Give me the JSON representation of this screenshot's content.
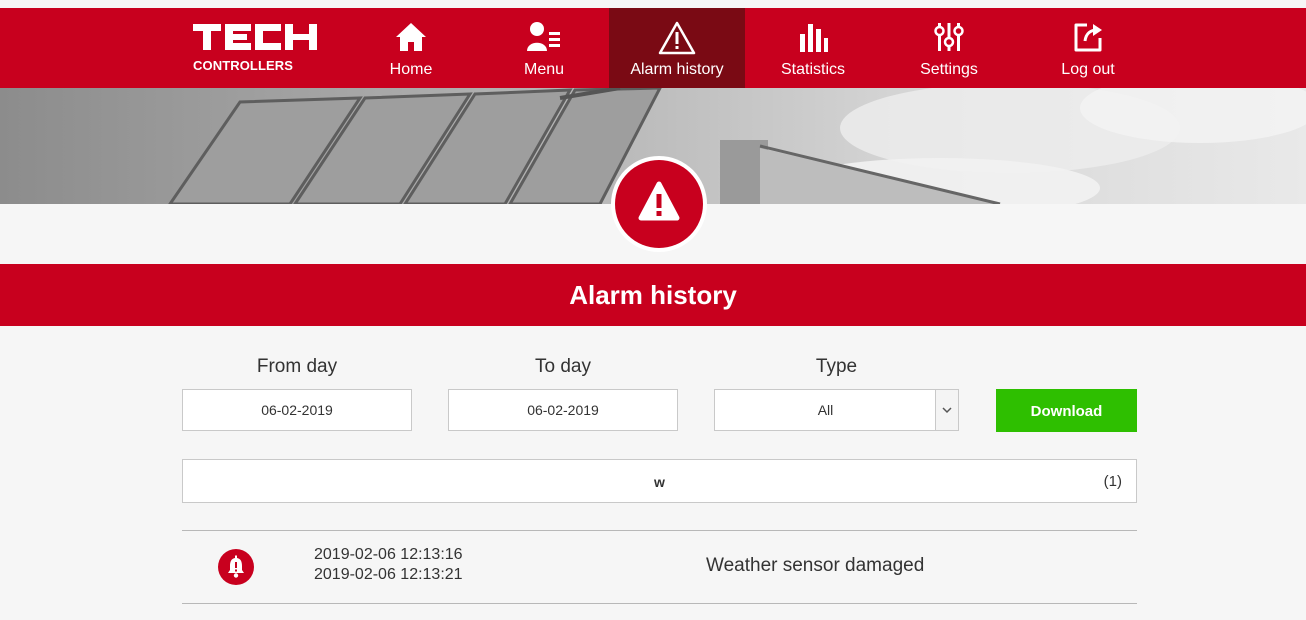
{
  "brand": {
    "logo_sub": "CONTROLLERS",
    "accent": "#c8001e",
    "active_nav": "#7a0a14",
    "download_color": "#2ebf00"
  },
  "nav": {
    "home": "Home",
    "menu": "Menu",
    "alarm_history": "Alarm history",
    "statistics": "Statistics",
    "settings": "Settings",
    "logout": "Log out"
  },
  "page": {
    "title": "Alarm history"
  },
  "filters": {
    "from_label": "From day",
    "from_value": "06-02-2019",
    "to_label": "To day",
    "to_value": "06-02-2019",
    "type_label": "Type",
    "type_value": "All",
    "download_label": "Download"
  },
  "group": {
    "label": "w",
    "count": "(1)"
  },
  "alarms": [
    {
      "start": "2019-02-06 12:13:16",
      "end": "2019-02-06 12:13:21",
      "message": "Weather sensor damaged"
    }
  ],
  "icons": {
    "home": "home-icon",
    "menu": "user-menu-icon",
    "alarm": "warning-triangle-icon",
    "statistics": "bar-chart-icon",
    "settings": "sliders-icon",
    "logout": "logout-icon"
  }
}
